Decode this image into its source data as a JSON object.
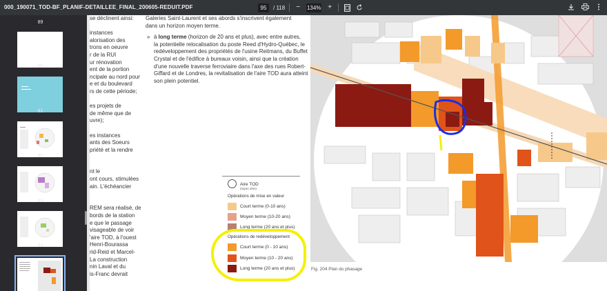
{
  "viewer": {
    "filename": "000_190071_TOD-BF_PLANIF-DETAILLEE_FINAL_200605-REDUIT.PDF",
    "current_page": "95",
    "total_pages": "/ 118",
    "zoom": "134%",
    "minus": "−",
    "plus": "+"
  },
  "sidebar": {
    "thumbnails": [
      {
        "num": "89"
      },
      {
        "num": "90"
      },
      {
        "num": "91"
      },
      {
        "num": "92"
      },
      {
        "num": "93"
      },
      {
        "num": "94"
      }
    ]
  },
  "document": {
    "left_column": [
      "se déclinent ainsi:",
      "",
      "instances",
      "alorisation des",
      "trons en oeuvre",
      "r de la RUI",
      "ur rénovation",
      "ent de la portion",
      "ncipale au nord pour",
      "e et du boulevard",
      "rs de cette période;",
      "",
      "es projets de",
      "de même que de",
      "uvre);",
      "",
      "es instances",
      "ants des Soeurs",
      "priété et la rendre",
      "",
      "",
      "nt le",
      "ont cours, stimulées",
      "ain. L'échéancier",
      "",
      "",
      "REM sera réalisé, de",
      "bords de la station",
      "e que le passage",
      "visageable de voir",
      "'aire TOD, à l'ouest",
      "Henri-Bourassa",
      "rid-Reid et Marcel-",
      "La construction",
      "nin Laval et du",
      "is-Franc devrait"
    ],
    "mid_intro": [
      "Galeries Saint-Laurent et ses abords s'inscrivent également",
      "dans un horizon moyen terme."
    ],
    "bullet_bold": "long terme",
    "bullet_first_prefix": "à ",
    "bullet_first_rest": " (horizon de 20 ans et plus), avec entre autres,",
    "bullet_lines": [
      "la potentielle relocalisation du poste Reed d'Hydro-Québec, le",
      "redéveloppement des propriétés de l'usine Reitmans, du Buffet",
      "Crystal et de l'édifice à bureaux voisin, ainsi que la création",
      "d'une nouvelle traverse ferroviaire dans l'axe des rues Robert-",
      "Giffard et de Londres, la revitalisation de l'aire TOD aura atteint",
      "son plein potentiel."
    ],
    "bullet_symbol": "»"
  },
  "legend": {
    "aire_label": "Aire TOD",
    "aire_sub": "(rayon 1km)",
    "mise_en_valeur_title": "Opérations de mise en valeur",
    "mise_en_valeur": [
      {
        "label": "Court terme (0-10 ans)",
        "color": "#f6c98a"
      },
      {
        "label": "Moyen terme (10-20 ans)",
        "color": "#e8a08a"
      },
      {
        "label": "Long terme (20 ans et plus)",
        "color": "#b8806e"
      }
    ],
    "redev_title": "Opérations de redéveloppement",
    "redev": [
      {
        "label": "Court terme (0 - 10 ans)",
        "color": "#f39a2a"
      },
      {
        "label": "Moyen terme (10 - 20 ans)",
        "color": "#e0531a"
      },
      {
        "label": "Long terme (20 ans et plus)",
        "color": "#8b1a12"
      }
    ],
    "highlight_color": "#f5f000"
  },
  "map": {
    "caption": "Fig. 204 Plan du phasage",
    "colors": {
      "road": "#c8c8c8",
      "block": "#e6e6e6",
      "tod_area": "#ffffff",
      "outside": "#dcdcdc",
      "rail": "#f2c89a",
      "annotation_blue": "#1a2ee6",
      "annotation_yellow": "#f5f000"
    }
  }
}
